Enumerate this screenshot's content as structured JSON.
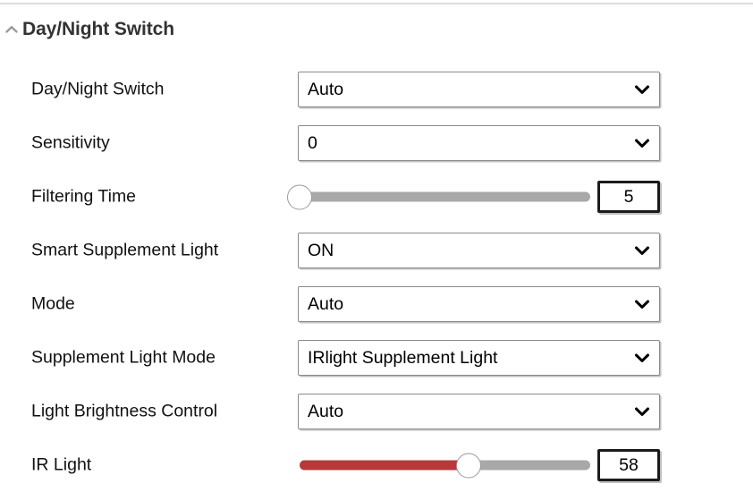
{
  "section": {
    "title": "Day/Night Switch",
    "collapse_icon": "chevron-up-icon",
    "expanded": true
  },
  "colors": {
    "slider_fill": "#b8393c",
    "slider_track": "#a8a8a8",
    "title_text": "#333333",
    "divider": "#dddddd",
    "select_border": "#8a8a8a",
    "value_box_border": "#1b1b1b"
  },
  "rows": [
    {
      "label": "Day/Night Switch",
      "type": "select",
      "value": "Auto",
      "arrow_icon": "chevron-down-icon"
    },
    {
      "label": "Sensitivity",
      "type": "select",
      "value": "0",
      "arrow_icon": "chevron-down-icon"
    },
    {
      "label": "Filtering Time",
      "type": "slider",
      "value": "5",
      "percent": 0,
      "unit": ""
    },
    {
      "label": "Smart Supplement Light",
      "type": "select",
      "value": "ON",
      "arrow_icon": "chevron-down-icon"
    },
    {
      "label": "Mode",
      "type": "select",
      "value": "Auto",
      "arrow_icon": "chevron-down-icon"
    },
    {
      "label": "Supplement Light Mode",
      "type": "select",
      "value": "IRlight Supplement Light",
      "arrow_icon": "chevron-down-icon"
    },
    {
      "label": "Light Brightness Control",
      "type": "select",
      "value": "Auto",
      "arrow_icon": "chevron-down-icon"
    },
    {
      "label": "IR Light",
      "type": "slider",
      "value": "58",
      "percent": 58,
      "unit": ""
    }
  ]
}
